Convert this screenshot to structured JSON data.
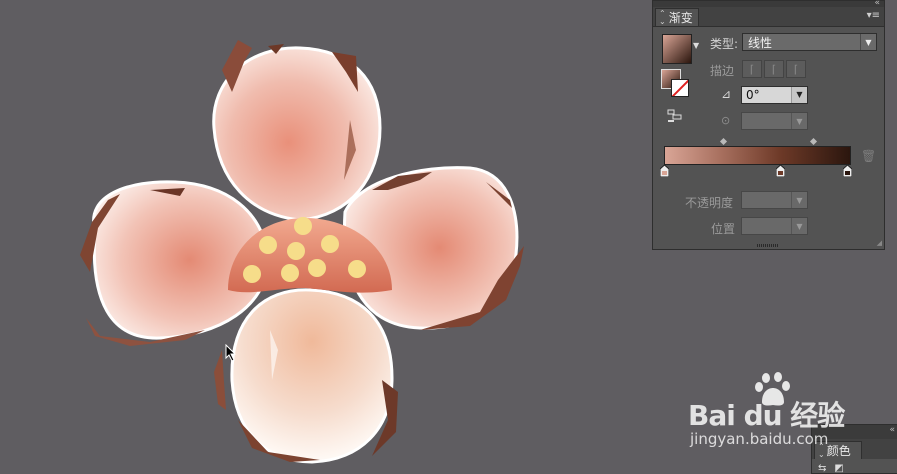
{
  "gradient_panel": {
    "tab_label": "渐变",
    "type_label": "类型:",
    "type_value": "线性",
    "stroke_label": "描边",
    "angle_value": "0°",
    "opacity_label": "不透明度",
    "position_label": "位置",
    "gradient_colors": [
      "#d9a596",
      "#a8705f",
      "#6e3a28",
      "#2b160e"
    ]
  },
  "color_panel": {
    "tab_label": "颜色"
  },
  "watermark": {
    "brand": "Bai du 经验",
    "url": "jingyan.baidu.com"
  },
  "icons": [
    "panel-menu-icon",
    "angle-icon",
    "aspect-ratio-icon",
    "trash-icon",
    "align-icon",
    "mouse-cursor-icon",
    "paw-icon"
  ]
}
